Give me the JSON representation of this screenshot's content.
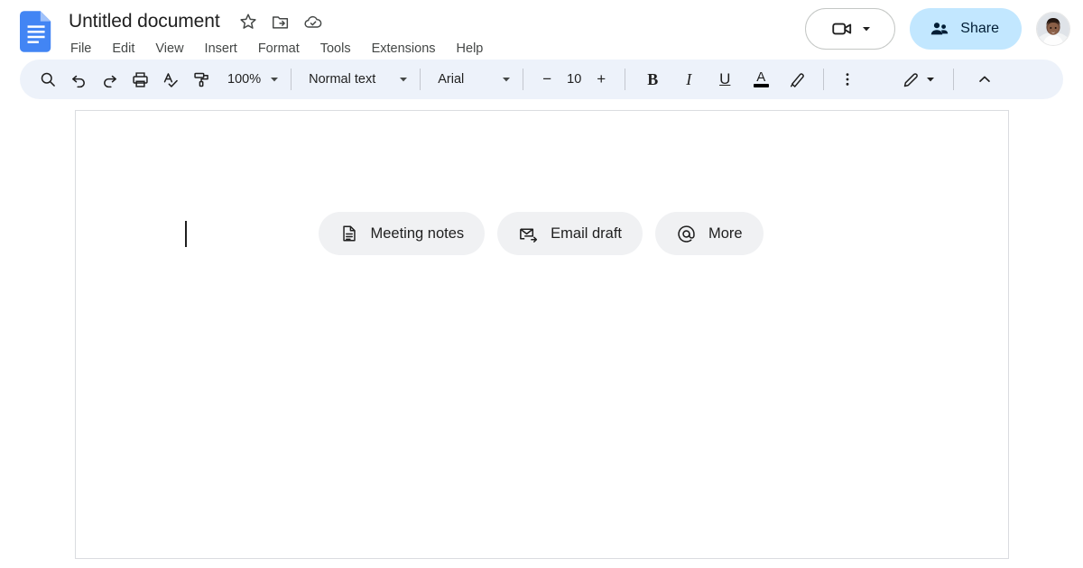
{
  "app": {
    "name": "Google Docs",
    "logo_icon": "google-docs-icon",
    "logo_color": "#4285f4"
  },
  "header": {
    "doc_title": "Untitled document",
    "title_icons": [
      {
        "name": "star-icon",
        "label": "Star"
      },
      {
        "name": "move-to-folder-icon",
        "label": "Move"
      },
      {
        "name": "cloud-saved-icon",
        "label": "Saved to Drive"
      }
    ],
    "menu": [
      {
        "label": "File"
      },
      {
        "label": "Edit"
      },
      {
        "label": "View"
      },
      {
        "label": "Insert"
      },
      {
        "label": "Format"
      },
      {
        "label": "Tools"
      },
      {
        "label": "Extensions"
      },
      {
        "label": "Help"
      }
    ],
    "meet_button": {
      "icon": "video-camera-icon",
      "has_dropdown": true
    },
    "share_button": {
      "label": "Share",
      "icon": "people-icon",
      "background": "#c2e7ff",
      "text_color": "#001d35"
    },
    "avatar": {
      "name": "account-avatar"
    }
  },
  "toolbar": {
    "background": "#edf2fa",
    "search_icon": "search-icon",
    "undo_icon": "undo-icon",
    "redo_icon": "redo-icon",
    "print_icon": "print-icon",
    "spellcheck_icon": "spellcheck-icon",
    "paint_format_icon": "paint-format-icon",
    "zoom_value": "100%",
    "style_value": "Normal text",
    "font_value": "Arial",
    "font_size_decrease": "−",
    "font_size_value": "10",
    "font_size_increase": "+",
    "bold_label": "B",
    "italic_label": "I",
    "underline_label": "U",
    "text_color_label": "A",
    "text_color_swatch": "#000000",
    "highlight_icon": "highlight-pen-icon",
    "more_options_icon": "more-vertical-icon",
    "edit_mode_icon": "pencil-icon",
    "collapse_icon": "chevron-up-icon"
  },
  "document": {
    "cursor_visible": true,
    "chips": [
      {
        "label": "Meeting notes",
        "icon": "document-outline-icon"
      },
      {
        "label": "Email draft",
        "icon": "email-send-icon"
      },
      {
        "label": "More",
        "icon": "at-sign-icon"
      }
    ]
  }
}
